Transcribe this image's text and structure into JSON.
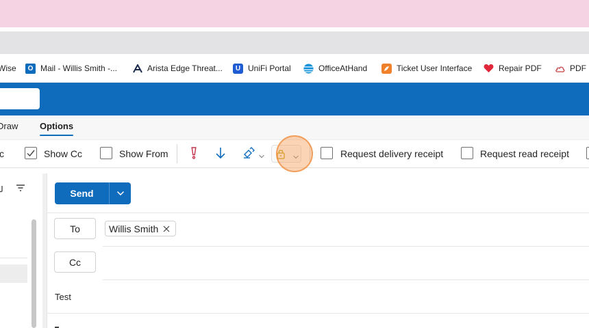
{
  "bookmarks": [
    {
      "label": "Wise",
      "icon": "wise-icon"
    },
    {
      "label": "Mail - Willis Smith -...",
      "icon": "outlook-icon",
      "color": "#0f6cbd"
    },
    {
      "label": "Arista Edge Threat...",
      "icon": "arista-icon"
    },
    {
      "label": "UniFi Portal",
      "icon": "unifi-icon",
      "color": "#1f5bd1"
    },
    {
      "label": "OfficeAtHand",
      "icon": "att-globe-icon",
      "color": "#0b8fd9"
    },
    {
      "label": "Ticket User Interface",
      "icon": "kangaroo-icon",
      "color": "#f0802a"
    },
    {
      "label": "Repair PDF",
      "icon": "heart-icon",
      "color": "#e0283a"
    },
    {
      "label": "PDF C",
      "icon": "cloud-icon"
    }
  ],
  "tabs": {
    "draw": "Draw",
    "options": "Options"
  },
  "ribbon": {
    "bcc_fragment": "c",
    "show_cc": "Show Cc",
    "show_cc_checked": true,
    "show_from": "Show From",
    "request_delivery_receipt": "Request delivery receipt",
    "request_read_receipt": "Request read receipt"
  },
  "compose": {
    "send_label": "Send",
    "to_label": "To",
    "cc_label": "Cc",
    "recipient": "Willis Smith",
    "subject": "Test"
  },
  "colors": {
    "accent": "#0f6cbd",
    "importance": "#c4314b"
  }
}
